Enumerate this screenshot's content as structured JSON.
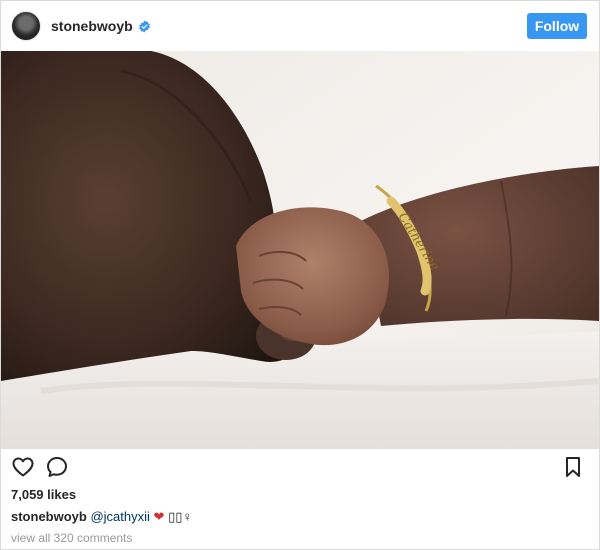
{
  "header": {
    "username": "stonebwoyb",
    "follow_label": "Follow",
    "accent_color": "#3897f0"
  },
  "photo": {
    "description_icon": "image",
    "bracelet_name": "Catherine"
  },
  "actions": {
    "like_icon": "heart-outline-icon",
    "comment_icon": "comment-icon",
    "save_icon": "bookmark-icon"
  },
  "likes": "7,059 likes",
  "caption": {
    "username": "stonebwoyb",
    "mention": "@jcathyxii",
    "heart": "❤",
    "trailing": "▯▯♀"
  },
  "comments_link": "view all 320 comments"
}
